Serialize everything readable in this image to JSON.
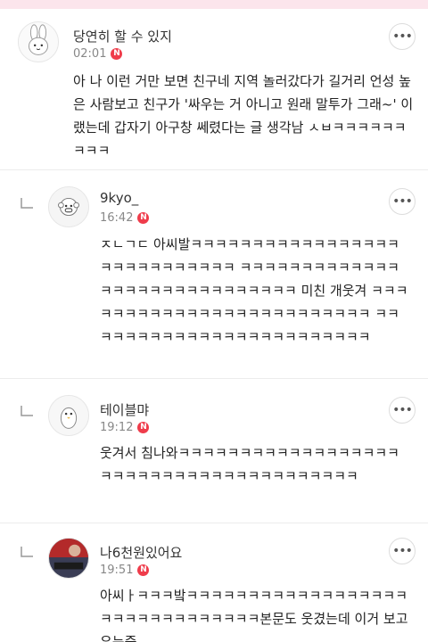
{
  "comments": [
    {
      "nickname": "당연히 할 수 있지",
      "time": "02:01",
      "badge": "N",
      "more": "•••",
      "text": "아 나 이런 거만 보면 친구네 지역 놀러갔다가 길거리 언성 높은 사람보고 친구가 '싸우는 거 아니고 원래 말투가 그래~' 이랬는데 갑자기 아구창 쎄렸다는 글 생각남 ㅅㅂㅋㅋㅋㅋㅋㅋㅋㅋㅋ"
    },
    {
      "nickname": "9kyo_",
      "time": "16:42",
      "badge": "N",
      "more": "•••",
      "text": "ㅈㄴㄱㄷ 아씨발ㅋㅋㅋㅋㅋㅋㅋㅋㅋㅋㅋㅋㅋㅋㅋㅋㅋㅋㅋㅋㅋㅋㅋㅋㅋㅋㅋㅋ ㅋㅋㅋㅋㅋㅋㅋㅋㅋㅋㅋㅋㅋㅋㅋㅋㅋㅋㅋㅋㅋㅋㅋㅋㅋㅋㅋㅋㅋ 미친 개웃겨 ㅋㅋㅋㅋㅋㅋㅋㅋㅋㅋㅋㅋㅋㅋㅋㅋㅋㅋㅋㅋㅋㅋㅋㅋㅋ ㅋㅋㅋㅋㅋㅋㅋㅋㅋㅋㅋㅋㅋㅋㅋㅋㅋㅋㅋㅋㅋㅋㅋㅋ"
    },
    {
      "nickname": "테이블먀",
      "time": "19:12",
      "badge": "N",
      "more": "•••",
      "text": "웃겨서 침나와ㅋㅋㅋㅋㅋㅋㅋㅋㅋㅋㅋㅋㅋㅋㅋㅋㅋㅋㅋㅋㅋㅋㅋㅋㅋㅋㅋㅋㅋㅋㅋㅋㅋㅋㅋㅋㅋㅋㅋ"
    },
    {
      "nickname": "나6천원있어요",
      "time": "19:51",
      "badge": "N",
      "more": "•••",
      "text": "아씨ㅏㅋㅋㅋ밬ㅋㅋㅋㅋㅋㅋㅋㅋㅋㅋㅋㅋㅋㅋㅋㅋㅋㅋㅋㅋㅋㅋㅋㅋㅋㅋㅋㅋㅋㅋㅋ본문도 웃겼는데 이거 보고 우는중"
    }
  ],
  "colors": {
    "badge": "#ef3c4b",
    "topbar": "#fce5ec"
  }
}
